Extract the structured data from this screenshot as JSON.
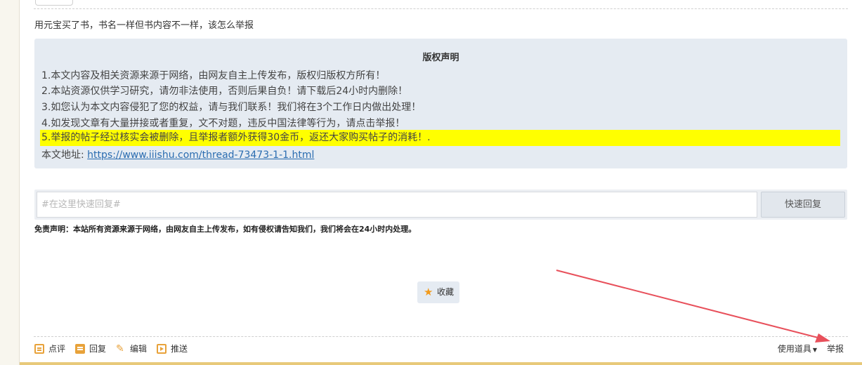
{
  "post": {
    "text": "用元宝买了书，书名一样但书内容不一样，该怎么举报"
  },
  "copyright": {
    "title": "版权声明",
    "lines": [
      "1.本文内容及相关资源来源于网络，由网友自主上传发布，版权归版权方所有！",
      "2.本站资源仅供学习研究，请勿非法使用，否则后果自负！请下载后24小时内删除！",
      "3.如您认为本文内容侵犯了您的权益，请与我们联系！我们将在3个工作日内做出处理！",
      "4.如发现文章有大量拼接或者重复，文不对题，违反中国法律等行为，请点击举报！"
    ],
    "highlight_line": "5.举报的帖子经过核实会被删除，且举报者额外获得30金币，返还大家购买帖子的消耗！.",
    "address_label": "本文地址: ",
    "address_url": "https://www.iiishu.com/thread-73473-1-1.html"
  },
  "reply": {
    "placeholder": "#在这里快速回复#",
    "button_label": "快速回复"
  },
  "disclaimer": "免责声明：本站所有资源来源于网络，由网友自主上传发布，如有侵权请告知我们，我们将会在24小时内处理。",
  "favorite": {
    "label": "收藏"
  },
  "actions": {
    "comment": "点评",
    "reply": "回复",
    "edit": "编辑",
    "push": "推送",
    "tools": "使用道具",
    "report": "举报"
  },
  "colors": {
    "highlight": "#ffff00",
    "accent": "#e8a23a",
    "arrow": "#e8505b",
    "panel": "#e5ebf2"
  }
}
